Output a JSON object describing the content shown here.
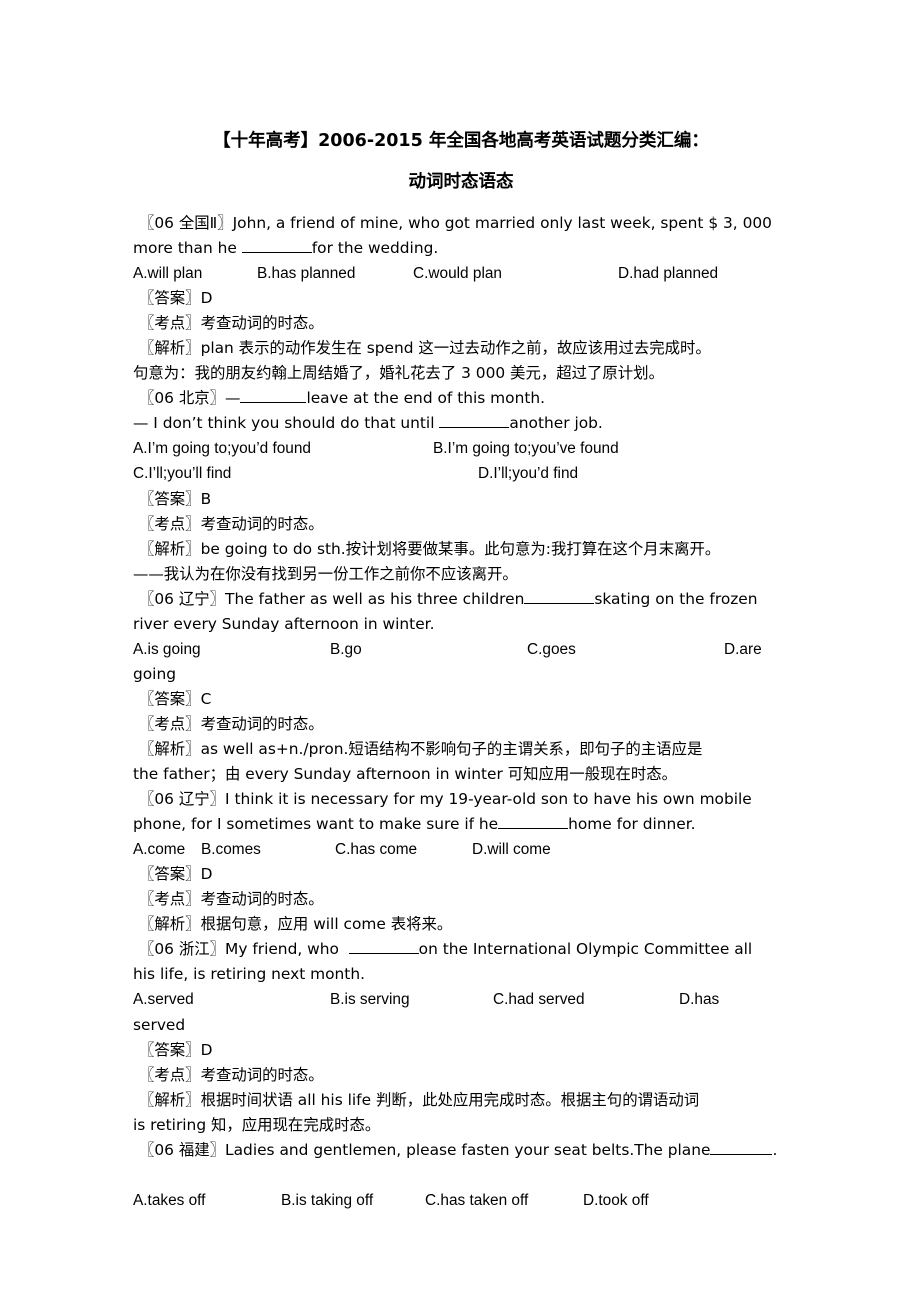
{
  "document": {
    "title": "【十年高考】2006-2015 年全国各地高考英语试题分类汇编：",
    "subtitle": "动词时态语态"
  },
  "questions": [
    {
      "source": "〖06 全国Ⅱ〗",
      "stem_line1": "〖06 全国Ⅱ〗John, a friend of mine, who got married only last week, spent $ 3, 000",
      "stem_line2_pre": "more than he ",
      "stem_line2_post": "for the wedding.",
      "options": {
        "a": "A.will plan",
        "b": "B.has planned",
        "c": "C.would plan",
        "d": "D.had planned"
      },
      "answer": "〖答案〗D",
      "point": "〖考点〗考查动词的时态。",
      "analysis_lines": [
        "〖解析〗plan 表示的动作发生在 spend 这一过去动作之前，故应该用过去完成时。",
        "句意为：我的朋友约翰上周结婚了，婚礼花去了 3 000 美元，超过了原计划。"
      ]
    },
    {
      "source": "〖06 北京〗",
      "stem_line1_pre": "〖06 北京〗—",
      "stem_line1_post": "leave at the end of this month.",
      "stem_line2_pre": "— I don’t think you should do that until ",
      "stem_line2_post": "another job.",
      "options_row1": {
        "a": "A.I’m going to;you’d found",
        "b": "B.I’m going to;you’ve found"
      },
      "options_row2": {
        "a": "C.I’ll;you’ll find",
        "b": "D.I’ll;you’d find"
      },
      "answer": "〖答案〗B",
      "point": "〖考点〗考查动词的时态。",
      "analysis_lines": [
        "〖解析〗be going to do sth.按计划将要做某事。此句意为:我打算在这个月末离开。",
        "——我认为在你没有找到另一份工作之前你不应该离开。"
      ]
    },
    {
      "source": "〖06 辽宁〗",
      "stem_line1_pre": "〖06 辽宁〗The father as well as his three children",
      "stem_line1_post": "skating on the frozen",
      "stem_line2": "river every Sunday afternoon in winter.",
      "options": {
        "a": "A.is going",
        "b": "B.go",
        "c": "C.goes",
        "d": "D.are"
      },
      "options_overflow": "going",
      "answer": "〖答案〗C",
      "point": "〖考点〗考查动词的时态。",
      "analysis_lines": [
        "〖解析〗as well as+n./pron.短语结构不影响句子的主谓关系，即句子的主语应是",
        "the father；由 every Sunday afternoon in winter 可知应用一般现在时态。"
      ]
    },
    {
      "source": "〖06 辽宁〗",
      "stem_line1": "〖06 辽宁〗I think it is necessary for my 19-year-old son to have his own mobile",
      "stem_line2_pre": "phone, for I sometimes want to make sure if he",
      "stem_line2_post": "home for dinner.",
      "options": {
        "a": "A.come",
        "b": "B.comes",
        "c": "C.has come",
        "d": "D.will come"
      },
      "answer": "〖答案〗D",
      "point": "〖考点〗考查动词的时态。",
      "analysis_lines": [
        "〖解析〗根据句意，应用 will come 表将来。"
      ]
    },
    {
      "source": "〖06 浙江〗",
      "stem_line1_pre": "〖06 浙江〗My friend, who  ",
      "stem_line1_post": "on the International Olympic Committee all",
      "stem_line2": "his life, is retiring next month.",
      "options": {
        "a": "A.served",
        "b": "B.is serving",
        "c": "C.had served",
        "d": "D.has"
      },
      "options_overflow": "served",
      "answer": "〖答案〗D",
      "point": "〖考点〗考查动词的时态。",
      "analysis_lines": [
        "〖解析〗根据时间状语 all his life 判断，此处应用完成时态。根据主句的谓语动词",
        "is retiring 知，应用现在完成时态。"
      ]
    },
    {
      "source": "〖06 福建〗",
      "stem_line1_pre": "〖06 福建〗Ladies and gentlemen, please fasten your seat belts.The plane",
      "stem_line1_post": ".",
      "options": {
        "a": "A.takes off",
        "b": "B.is taking off",
        "c": "C.has taken off",
        "d": "D.took off"
      }
    }
  ]
}
